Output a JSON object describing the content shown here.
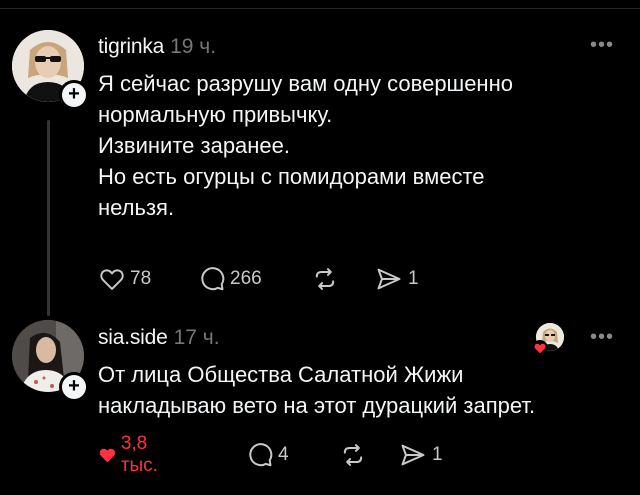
{
  "posts": [
    {
      "username": "tigrinka",
      "time": "19 ч.",
      "text_lines": [
        "Я сейчас разрушу вам одну совершенно",
        "нормальную привычку.",
        "Извините заранее.",
        "Но есть огурцы с помидорами вместе",
        "нельзя."
      ],
      "likes": "78",
      "comments": "266",
      "shares": "1",
      "liked": false,
      "more_icon": "ellipsis-icon"
    },
    {
      "username": "sia.side",
      "time": "17 ч.",
      "text_lines": [
        "От лица Общества Салатной Жижи",
        "накладываю вето на этот дурацкий запрет."
      ],
      "likes": "3,8 тыс.",
      "comments": "4",
      "shares": "1",
      "liked": true,
      "more_icon": "ellipsis-icon"
    }
  ],
  "colors": {
    "background": "#000000",
    "text": "#f3f5f7",
    "muted": "#777777",
    "like_active": "#ff3040"
  }
}
